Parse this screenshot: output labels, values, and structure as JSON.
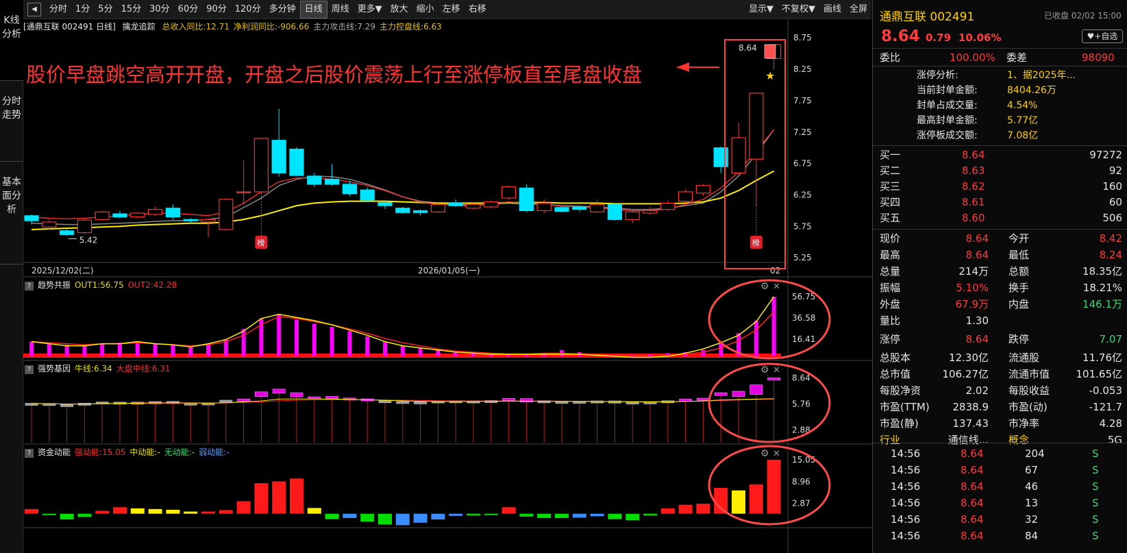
{
  "toolbar": {
    "back": "◀",
    "items": [
      "分时",
      "1分",
      "5分",
      "15分",
      "30分",
      "60分",
      "90分",
      "120分",
      "多分钟",
      "日线",
      "周线",
      "更多▼",
      "放大",
      "缩小",
      "左移",
      "右移"
    ],
    "active": "日线",
    "right": [
      "显示▼",
      "不复权▼",
      "画线",
      "全屏"
    ]
  },
  "vtabs": [
    "K线分析",
    "分时走势",
    "基本面分析"
  ],
  "main_panel": {
    "title": "[通鼎互联 002491 日线]",
    "indicator": "擒龙追踪",
    "stats": [
      {
        "text": "总收入同比:12.71",
        "color": "#e6c000"
      },
      {
        "text": "净利润同比:-906.66",
        "color": "#e6c000"
      },
      {
        "text": "主力攻击线:7.29",
        "color": "#aaaaaa"
      },
      {
        "text": "主力控盘线:6.63",
        "color": "#e6c000"
      }
    ]
  },
  "annotation": "股价早盘跳空高开开盘，开盘之后股价震荡上行至涨停板直至尾盘收盘",
  "panel2": {
    "name": "趋势共振",
    "lines": [
      {
        "text": "OUT1:56.75",
        "color": "#e6e000"
      },
      {
        "text": "OUT2:42.28",
        "color": "#ff2a2a"
      }
    ]
  },
  "panel3": {
    "name": "强势基因",
    "lines": [
      {
        "text": "牛线:6.34",
        "color": "#e6e000"
      },
      {
        "text": "大盘中线:6.31",
        "color": "#ff2a2a"
      }
    ]
  },
  "panel4": {
    "name": "资金动能",
    "lines": [
      {
        "text": "强动能:15.05",
        "color": "#ff2a2a"
      },
      {
        "text": "中动能:-",
        "color": "#e6e000"
      },
      {
        "text": "无动能:-",
        "color": "#3bd67a"
      },
      {
        "text": "弱动能:-",
        "color": "#5aa0ff"
      }
    ]
  },
  "chart_data": [
    {
      "type": "candlestick",
      "title": "通鼎互联 002491 日线",
      "y_ticks": [
        "8.75",
        "8.25",
        "7.75",
        "7.25",
        "6.75",
        "6.25",
        "5.75",
        "5.25"
      ],
      "ylim": [
        5.1,
        8.85
      ],
      "x_labels": [
        "2025/12/02(二)",
        "2026/01/05(一)",
        "02"
      ],
      "candles": [
        [
          5.92,
          5.84,
          5.94,
          5.78
        ],
        [
          5.74,
          5.82,
          5.86,
          5.7
        ],
        [
          5.68,
          5.62,
          5.72,
          5.6
        ],
        [
          5.65,
          5.85,
          5.87,
          5.63
        ],
        [
          5.86,
          5.98,
          6.0,
          5.84
        ],
        [
          5.95,
          5.9,
          6.0,
          5.88
        ],
        [
          5.9,
          5.96,
          5.98,
          5.88
        ],
        [
          5.94,
          6.02,
          6.06,
          5.92
        ],
        [
          6.04,
          5.9,
          6.1,
          5.86
        ],
        [
          5.86,
          5.84,
          5.88,
          5.8
        ],
        [
          5.82,
          5.86,
          5.88,
          5.58
        ],
        [
          5.7,
          6.18,
          6.2,
          5.68
        ],
        [
          6.3,
          6.3,
          6.8,
          6.1
        ],
        [
          6.3,
          7.15,
          7.16,
          6.28
        ],
        [
          7.12,
          6.6,
          7.62,
          6.54
        ],
        [
          6.98,
          6.56,
          7.01,
          6.55
        ],
        [
          6.55,
          6.42,
          6.6,
          6.38
        ],
        [
          6.5,
          6.42,
          6.74,
          6.4
        ],
        [
          6.42,
          6.27,
          6.48,
          6.23
        ],
        [
          6.33,
          6.17,
          6.37,
          6.13
        ],
        [
          6.13,
          6.08,
          6.15,
          6.03
        ],
        [
          6.04,
          5.97,
          6.06,
          5.95
        ],
        [
          6.0,
          5.97,
          6.02,
          5.92
        ],
        [
          5.98,
          6.1,
          6.14,
          5.96
        ],
        [
          6.12,
          6.08,
          6.18,
          6.06
        ],
        [
          6.04,
          6.1,
          6.12,
          6.02
        ],
        [
          6.06,
          6.14,
          6.16,
          6.04
        ],
        [
          6.2,
          6.38,
          6.4,
          6.18
        ],
        [
          6.36,
          6.0,
          6.42,
          5.98
        ],
        [
          6.0,
          6.12,
          6.18,
          5.96
        ],
        [
          6.05,
          5.99,
          6.07,
          5.97
        ],
        [
          6.06,
          6.02,
          6.08,
          5.98
        ],
        [
          5.98,
          6.1,
          6.18,
          5.96
        ],
        [
          6.1,
          5.86,
          6.12,
          5.84
        ],
        [
          5.86,
          5.98,
          6.0,
          5.8
        ],
        [
          5.96,
          6.0,
          6.06,
          5.94
        ],
        [
          6.02,
          6.12,
          6.16,
          6.0
        ],
        [
          6.15,
          6.3,
          6.34,
          6.12
        ],
        [
          6.28,
          6.4,
          6.42,
          6.24
        ],
        [
          7.0,
          6.7,
          7.02,
          6.6
        ],
        [
          6.6,
          7.16,
          7.4,
          6.54
        ],
        [
          6.82,
          7.87,
          7.87,
          6.08
        ],
        [
          8.42,
          8.64,
          8.64,
          8.24
        ]
      ],
      "ma_gray": [
        5.8,
        5.79,
        5.78,
        5.78,
        5.79,
        5.8,
        5.81,
        5.83,
        5.84,
        5.84,
        5.86,
        5.9,
        6.05,
        6.2,
        6.4,
        6.5,
        6.55,
        6.54,
        6.5,
        6.42,
        6.33,
        6.22,
        6.15,
        6.12,
        6.1,
        6.09,
        6.1,
        6.12,
        6.1,
        6.1,
        6.08,
        6.07,
        6.06,
        6.04,
        6.02,
        6.02,
        6.04,
        6.08,
        6.12,
        6.3,
        6.55,
        6.9,
        7.29
      ],
      "ma_yellow": [
        5.7,
        5.71,
        5.72,
        5.73,
        5.74,
        5.75,
        5.77,
        5.78,
        5.79,
        5.8,
        5.8,
        5.82,
        5.86,
        5.92,
        6.0,
        6.08,
        6.12,
        6.14,
        6.15,
        6.15,
        6.15,
        6.14,
        6.13,
        6.12,
        6.12,
        6.12,
        6.12,
        6.13,
        6.13,
        6.13,
        6.12,
        6.12,
        6.12,
        6.11,
        6.11,
        6.11,
        6.11,
        6.12,
        6.14,
        6.2,
        6.32,
        6.48,
        6.63
      ],
      "low_label": "5.42",
      "last_label": "8.64",
      "badges": [
        "榜",
        "榜"
      ]
    },
    {
      "type": "bar_line",
      "name": "趋势共振",
      "y_ticks": [
        "56.75",
        "36.58",
        "16.41"
      ],
      "ylim": [
        0,
        60
      ],
      "bars": [
        14,
        12,
        11,
        11,
        12,
        13,
        14,
        12,
        11,
        10,
        12,
        16,
        26,
        36,
        40,
        35,
        31,
        28,
        24,
        19,
        14,
        10,
        8,
        6,
        4,
        3,
        2,
        2,
        2,
        3,
        6,
        4,
        2,
        1,
        1,
        2,
        3,
        4,
        6,
        12,
        22,
        34,
        56.75
      ],
      "out1": [
        14,
        12,
        10,
        10,
        12,
        12,
        14,
        12,
        11,
        9,
        12,
        16,
        24,
        36,
        40,
        37,
        34,
        30,
        25,
        20,
        14,
        10,
        8,
        6,
        4,
        3,
        2,
        2,
        2,
        2,
        2,
        2,
        1,
        0,
        -1,
        -1,
        0,
        3,
        7,
        13,
        20,
        33,
        56.75
      ],
      "out2": [
        14,
        13,
        12,
        11,
        12,
        12,
        13,
        12,
        11,
        10,
        11,
        14,
        20,
        30,
        38,
        36,
        33,
        30,
        26,
        22,
        17,
        13,
        10,
        7,
        5,
        4,
        3,
        2,
        2,
        3,
        3,
        2,
        2,
        1,
        0,
        0,
        1,
        2,
        4,
        8,
        15,
        25,
        42.28
      ]
    },
    {
      "type": "bar_line",
      "name": "强势基因",
      "y_ticks": [
        "8.64",
        "5.76",
        "2.88"
      ],
      "ylim": [
        1.5,
        8.9
      ],
      "blocks": [
        [
          5.84,
          5.8
        ],
        [
          5.82,
          5.74
        ],
        [
          5.7,
          5.65
        ],
        [
          5.85,
          5.75
        ],
        [
          5.98,
          5.9
        ],
        [
          5.96,
          5.9
        ],
        [
          5.96,
          5.9
        ],
        [
          6.02,
          5.94
        ],
        [
          6.04,
          5.9
        ],
        [
          5.86,
          5.84
        ],
        [
          5.88,
          5.84
        ],
        [
          6.18,
          5.9
        ],
        [
          6.3,
          6.1
        ],
        [
          7.1,
          6.6
        ],
        [
          7.4,
          6.95
        ],
        [
          7.0,
          6.55
        ],
        [
          6.55,
          6.42
        ],
        [
          6.6,
          6.4
        ],
        [
          6.42,
          6.27
        ],
        [
          6.33,
          6.17
        ],
        [
          6.13,
          6.08
        ],
        [
          6.04,
          5.97
        ],
        [
          6.0,
          5.97
        ],
        [
          6.1,
          5.98
        ],
        [
          6.12,
          6.08
        ],
        [
          6.1,
          6.04
        ],
        [
          6.14,
          6.06
        ],
        [
          6.38,
          6.2
        ],
        [
          6.36,
          6.0
        ],
        [
          6.12,
          6.0
        ],
        [
          6.05,
          5.99
        ],
        [
          6.06,
          6.02
        ],
        [
          6.1,
          5.98
        ],
        [
          6.1,
          5.86
        ],
        [
          5.98,
          5.86
        ],
        [
          6.0,
          5.96
        ],
        [
          6.12,
          6.02
        ],
        [
          6.3,
          6.15
        ],
        [
          6.4,
          6.28
        ],
        [
          7.0,
          6.7
        ],
        [
          7.16,
          6.6
        ],
        [
          7.87,
          6.82
        ],
        [
          8.64,
          8.42
        ]
      ],
      "bull": [
        5.8,
        5.79,
        5.75,
        5.76,
        5.8,
        5.83,
        5.86,
        5.88,
        5.9,
        5.88,
        5.86,
        5.9,
        6.0,
        6.1,
        6.3,
        6.32,
        6.32,
        6.3,
        6.27,
        6.22,
        6.17,
        6.11,
        6.06,
        6.04,
        6.04,
        6.05,
        6.06,
        6.08,
        6.08,
        6.06,
        6.05,
        6.05,
        6.04,
        6.02,
        6.0,
        5.99,
        6.0,
        6.04,
        6.1,
        6.2,
        6.26,
        6.3,
        6.34
      ],
      "market": [
        5.78,
        5.78,
        5.76,
        5.76,
        5.78,
        5.8,
        5.82,
        5.84,
        5.86,
        5.86,
        5.86,
        5.88,
        5.94,
        6.0,
        6.12,
        6.18,
        6.22,
        6.24,
        6.24,
        6.22,
        6.2,
        6.18,
        6.15,
        6.12,
        6.11,
        6.1,
        6.1,
        6.1,
        6.1,
        6.09,
        6.08,
        6.07,
        6.06,
        6.05,
        6.04,
        6.03,
        6.03,
        6.05,
        6.08,
        6.14,
        6.2,
        6.26,
        6.31
      ]
    },
    {
      "type": "bar",
      "name": "资金动能",
      "y_ticks": [
        "15.05",
        "8.96",
        "2.87"
      ],
      "ylim": [
        -3.5,
        15.6
      ],
      "bars": [
        1.3,
        -0.4,
        -1.6,
        -0.9,
        0.8,
        1.8,
        1.5,
        1.3,
        1.1,
        0.6,
        0.6,
        1.0,
        3.5,
        8.5,
        9.0,
        9.8,
        1.6,
        -1.5,
        -1.2,
        -2.2,
        -3.0,
        -3.2,
        -2.5,
        -1.6,
        -0.6,
        -0.5,
        -0.4,
        1.8,
        -0.8,
        -1.2,
        -1.2,
        -1.1,
        -0.7,
        -1.5,
        -1.8,
        -0.5,
        1.5,
        2.5,
        2.8,
        7.2,
        6.5,
        8.2,
        15.05
      ],
      "colors": [
        "r",
        "g",
        "g",
        "g",
        "r",
        "r",
        "y",
        "y",
        "y",
        "y",
        "r",
        "r",
        "r",
        "r",
        "r",
        "r",
        "y",
        "g",
        "b",
        "g",
        "g",
        "b",
        "b",
        "b",
        "b",
        "g",
        "g",
        "r",
        "g",
        "g",
        "g",
        "b",
        "b",
        "g",
        "g",
        "g",
        "r",
        "r",
        "r",
        "r",
        "y",
        "r",
        "r"
      ]
    }
  ],
  "quote": {
    "name": "通鼎互联",
    "code": "002491",
    "status": "已收盘 02/02 15:00",
    "price": "8.64",
    "change": "0.79",
    "pct": "10.06%",
    "follow": "♥+自选",
    "weibi_label": "委比",
    "weibi": "100.00%",
    "weicha_label": "委差",
    "weicha": "98090",
    "limit": [
      {
        "k": "涨停分析:",
        "v": "1、据2025年..."
      },
      {
        "k": "当前封单金额:",
        "v": "8404.26万"
      },
      {
        "k": "封单占成交量:",
        "v": "4.54%"
      },
      {
        "k": "最高封单金额:",
        "v": "5.77亿"
      },
      {
        "k": "涨停板成交额:",
        "v": "7.08亿"
      }
    ],
    "book": [
      {
        "l": "买一",
        "p": "8.64",
        "v": "97272"
      },
      {
        "l": "买二",
        "p": "8.63",
        "v": "92"
      },
      {
        "l": "买三",
        "p": "8.62",
        "v": "160"
      },
      {
        "l": "买四",
        "p": "8.61",
        "v": "60"
      },
      {
        "l": "买五",
        "p": "8.60",
        "v": "506"
      }
    ],
    "stats": [
      [
        {
          "k": "现价",
          "v": "8.64",
          "c": "red"
        },
        {
          "k": "今开",
          "v": "8.42",
          "c": "red"
        }
      ],
      [
        {
          "k": "最高",
          "v": "8.64",
          "c": "red"
        },
        {
          "k": "最低",
          "v": "8.24",
          "c": "red"
        }
      ],
      [
        {
          "k": "总量",
          "v": "214万",
          "c": "white"
        },
        {
          "k": "总额",
          "v": "18.35亿",
          "c": "white"
        }
      ],
      [
        {
          "k": "振幅",
          "v": "5.10%",
          "c": "red"
        },
        {
          "k": "换手",
          "v": "18.21%",
          "c": "white"
        }
      ],
      [
        {
          "k": "外盘",
          "v": "67.9万",
          "c": "red"
        },
        {
          "k": "内盘",
          "v": "146.1万",
          "c": "green"
        }
      ],
      [
        {
          "k": "量比",
          "v": "1.30",
          "c": "white"
        },
        {
          "k": "",
          "v": "",
          "c": "white"
        }
      ],
      [
        {
          "k": "涨停",
          "v": "8.64",
          "c": "red"
        },
        {
          "k": "跌停",
          "v": "7.07",
          "c": "green"
        }
      ],
      [
        {
          "k": "总股本",
          "v": "12.30亿",
          "c": "white"
        },
        {
          "k": "流通股",
          "v": "11.76亿",
          "c": "white"
        }
      ],
      [
        {
          "k": "总市值",
          "v": "106.27亿",
          "c": "white"
        },
        {
          "k": "流通市值",
          "v": "101.65亿",
          "c": "white"
        }
      ],
      [
        {
          "k": "每股净资",
          "v": "2.02",
          "c": "white"
        },
        {
          "k": "每股收益",
          "v": "-0.053",
          "c": "white"
        }
      ],
      [
        {
          "k": "市盈(TTM)",
          "v": "2838.9",
          "c": "white"
        },
        {
          "k": "市盈(动)",
          "v": "-121.7",
          "c": "white"
        }
      ],
      [
        {
          "k": "市盈(静)",
          "v": "137.43",
          "c": "white"
        },
        {
          "k": "市净率",
          "v": "4.28",
          "c": "white"
        }
      ],
      [
        {
          "k": "行业",
          "v": "通信线...",
          "c": "white"
        },
        {
          "k": "概念",
          "v": "5G",
          "c": "white"
        }
      ]
    ],
    "ticks": [
      {
        "t": "14:56",
        "p": "8.64",
        "v": "204",
        "s": "S"
      },
      {
        "t": "14:56",
        "p": "8.64",
        "v": "67",
        "s": "S"
      },
      {
        "t": "14:56",
        "p": "8.64",
        "v": "46",
        "s": "S"
      },
      {
        "t": "14:56",
        "p": "8.64",
        "v": "13",
        "s": "S"
      },
      {
        "t": "14:56",
        "p": "8.64",
        "v": "32",
        "s": "S"
      },
      {
        "t": "14:56",
        "p": "8.64",
        "v": "84",
        "s": "S"
      }
    ]
  }
}
